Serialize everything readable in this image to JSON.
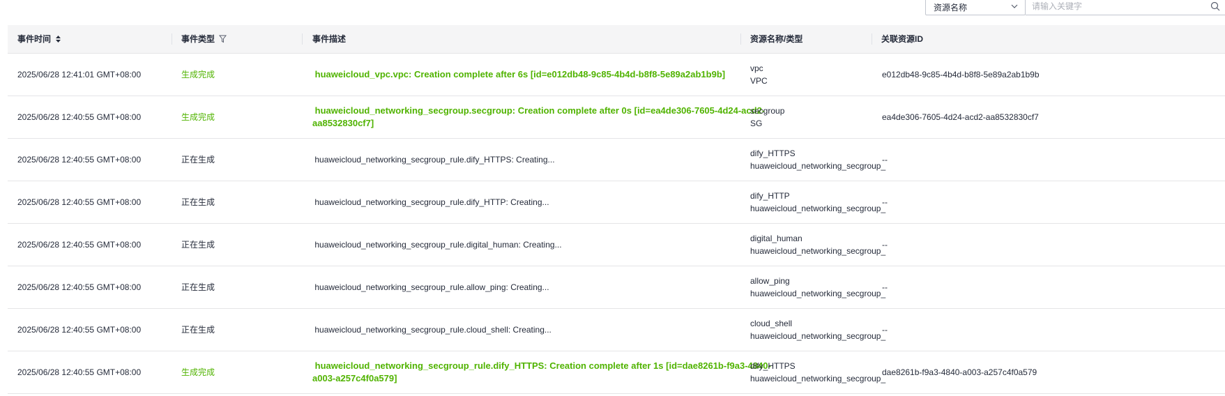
{
  "filter": {
    "select_value": "资源名称",
    "search_placeholder": "请输入关键字"
  },
  "table": {
    "headers": {
      "time": "事件时间",
      "type": "事件类型",
      "desc": "事件描述",
      "resource": "资源名称/类型",
      "related_id": "关联资源ID"
    },
    "rows": [
      {
        "time": "2025/06/28 12:41:01 GMT+08:00",
        "type": "生成完成",
        "status": "done",
        "desc": " huaweicloud_vpc.vpc: Creation complete after 6s [id=e012db48-9c85-4b4d-b8f8-5e89a2ab1b9b]",
        "res_name": "vpc",
        "res_type": "VPC",
        "related_id": "e012db48-9c85-4b4d-b8f8-5e89a2ab1b9b"
      },
      {
        "time": "2025/06/28 12:40:55 GMT+08:00",
        "type": "生成完成",
        "status": "done",
        "desc": " huaweicloud_networking_secgroup.secgroup: Creation complete after 0s [id=ea4de306-7605-4d24-acd2-aa8532830cf7]",
        "res_name": "secgroup",
        "res_type": "SG",
        "related_id": "ea4de306-7605-4d24-acd2-aa8532830cf7"
      },
      {
        "time": "2025/06/28 12:40:55 GMT+08:00",
        "type": "正在生成",
        "status": "doing",
        "desc": " huaweicloud_networking_secgroup_rule.dify_HTTPS: Creating...",
        "res_name": "dify_HTTPS",
        "res_type": "huaweicloud_networking_secgroup_",
        "related_id": "--"
      },
      {
        "time": "2025/06/28 12:40:55 GMT+08:00",
        "type": "正在生成",
        "status": "doing",
        "desc": " huaweicloud_networking_secgroup_rule.dify_HTTP: Creating...",
        "res_name": "dify_HTTP",
        "res_type": "huaweicloud_networking_secgroup_",
        "related_id": "--"
      },
      {
        "time": "2025/06/28 12:40:55 GMT+08:00",
        "type": "正在生成",
        "status": "doing",
        "desc": " huaweicloud_networking_secgroup_rule.digital_human: Creating...",
        "res_name": "digital_human",
        "res_type": "huaweicloud_networking_secgroup_",
        "related_id": "--"
      },
      {
        "time": "2025/06/28 12:40:55 GMT+08:00",
        "type": "正在生成",
        "status": "doing",
        "desc": " huaweicloud_networking_secgroup_rule.allow_ping: Creating...",
        "res_name": "allow_ping",
        "res_type": "huaweicloud_networking_secgroup_",
        "related_id": "--"
      },
      {
        "time": "2025/06/28 12:40:55 GMT+08:00",
        "type": "正在生成",
        "status": "doing",
        "desc": " huaweicloud_networking_secgroup_rule.cloud_shell: Creating...",
        "res_name": "cloud_shell",
        "res_type": "huaweicloud_networking_secgroup_",
        "related_id": "--"
      },
      {
        "time": "2025/06/28 12:40:55 GMT+08:00",
        "type": "生成完成",
        "status": "done",
        "desc": " huaweicloud_networking_secgroup_rule.dify_HTTPS: Creation complete after 1s [id=dae8261b-f9a3-4840-a003-a257c4f0a579]",
        "res_name": "dify_HTTPS",
        "res_type": "huaweicloud_networking_secgroup_",
        "related_id": "dae8261b-f9a3-4840-a003-a257c4f0a579"
      }
    ]
  },
  "colors": {
    "done": "#50b300",
    "doing": "#252b3a",
    "header_bg": "#f5f5f6"
  },
  "icons": {
    "sort": "sort-icon",
    "filter": "filter-icon",
    "dropdown": "chevron-down-icon",
    "search": "search-icon"
  }
}
